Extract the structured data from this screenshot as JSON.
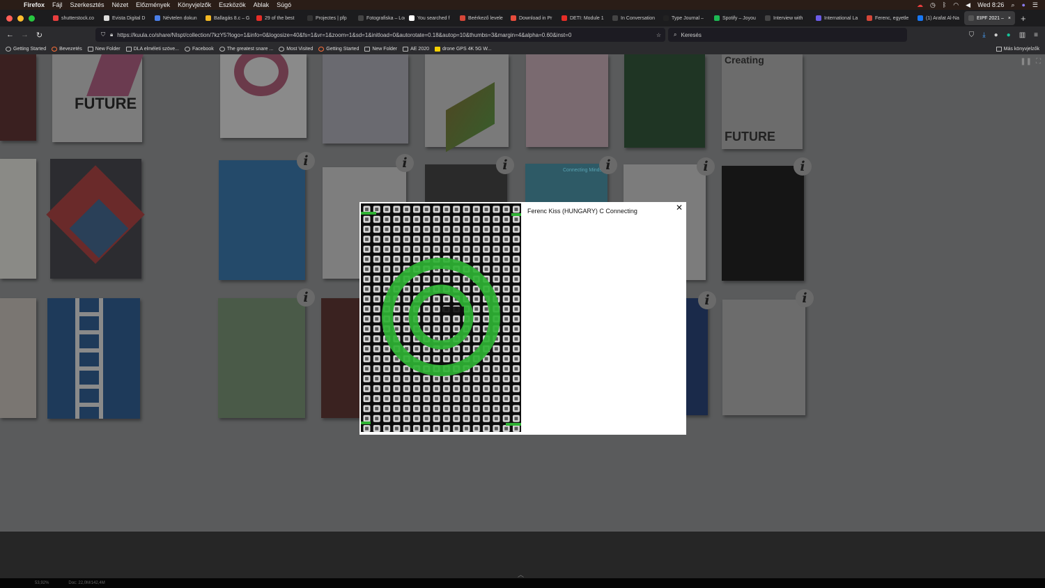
{
  "menubar": {
    "app": "Firefox",
    "items": [
      "Fájl",
      "Szerkesztés",
      "Nézet",
      "Előzmények",
      "Könyvjelzők",
      "Eszközök",
      "Ablak",
      "Súgó"
    ],
    "clock": "Wed 8:26"
  },
  "tabs": [
    {
      "label": "shutterstock.co",
      "color": "#e83e3e"
    },
    {
      "label": "Evista Digital D",
      "color": "#dddddd"
    },
    {
      "label": "Névtelen dokun",
      "color": "#4a7fe8"
    },
    {
      "label": "Ballagás 8.c – G",
      "color": "#f2b824"
    },
    {
      "label": "29 of the best",
      "color": "#e52d27"
    },
    {
      "label": "Projectes | pfp",
      "color": "#333333"
    },
    {
      "label": "Fotografiska – Logo",
      "color": "#444444"
    },
    {
      "label": "You searched f",
      "color": "#ffffff"
    },
    {
      "label": "Beérkező levele",
      "color": "#d44638"
    },
    {
      "label": "Download in Pr",
      "color": "#e74c3c"
    },
    {
      "label": "DETI: Module 1",
      "color": "#e52d27"
    },
    {
      "label": "In Conversation",
      "color": "#444444"
    },
    {
      "label": "Type Journal –",
      "color": "#222222"
    },
    {
      "label": "Spotify – Joyou",
      "color": "#1db954"
    },
    {
      "label": "Interview with",
      "color": "#444444"
    },
    {
      "label": "International La",
      "color": "#6b5ce7"
    },
    {
      "label": "Ferenc, egyetle",
      "color": "#d44638"
    },
    {
      "label": "(1) Arafat Al-Na",
      "color": "#1877f2"
    },
    {
      "label": "EIPF 2021 –",
      "color": "#555555",
      "active": true
    }
  ],
  "nav": {
    "url": "https://kuula.co/share/NIspt/collection/7kzY5?logo=1&info=0&logosize=40&fs=1&vr=1&zoom=1&sd=1&initload=0&autorotate=0.18&autop=10&thumbs=3&margin=4&alpha=0.60&inst=0",
    "search_placeholder": "Keresés"
  },
  "bookmarks": [
    "Getting Started",
    "Bevezetés",
    "New Folder",
    "DLA elméleti szöve...",
    "Facebook",
    "The greatest snare ...",
    "Most Visited",
    "Getting Started",
    "New Folder",
    "AE 2020",
    "drone GPS 4K 5G W..."
  ],
  "bookmarks_other": "Más könyvjelzők",
  "modal": {
    "title": "Ferenc Kiss (HUNGARY) C Connecting",
    "close_label": "✕"
  },
  "poster_texts": {
    "future": "FUTURE",
    "creating": "Creating",
    "connecting_minds": "Connecting Minds"
  },
  "statusbar": {
    "zoom": "53,92%",
    "doc": "Doc: 22,0M/142,4M"
  }
}
